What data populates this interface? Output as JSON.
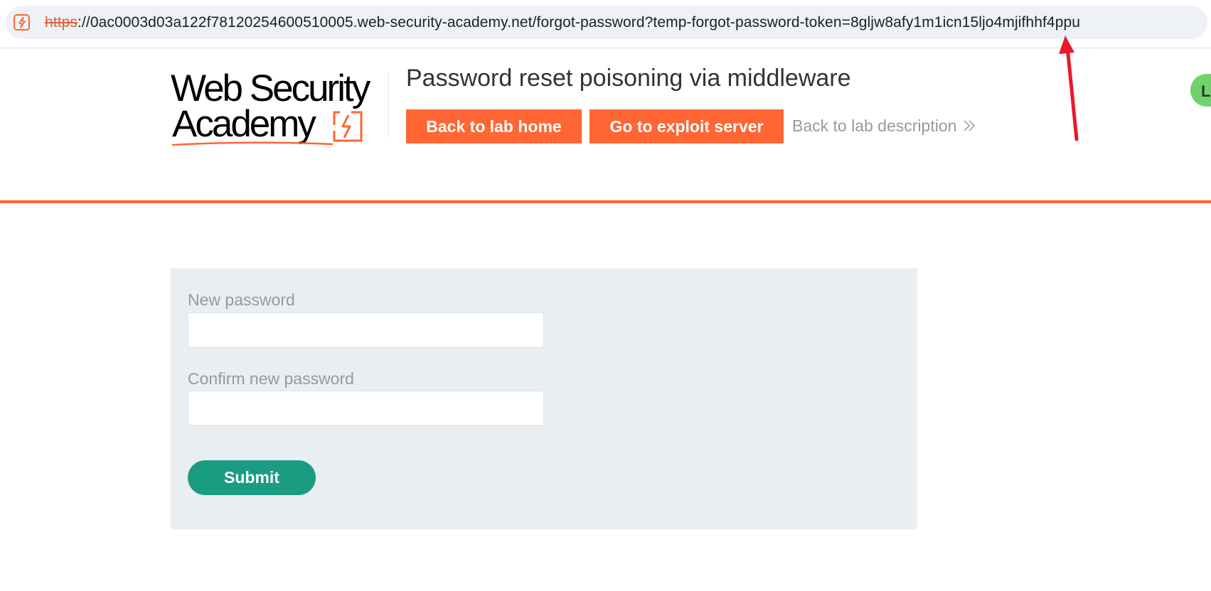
{
  "browser": {
    "url_scheme": "https",
    "url_rest": "://0ac0003d03a122f78120254600510005.web-security-academy.net/forgot-password?temp-forgot-password-token=8gljw8afy1m1icn15ljo4mjifhhf4ppu",
    "site_icon": "lightning-square-icon"
  },
  "header": {
    "logo_line1": "Web Security",
    "logo_line2": "Academy",
    "lab_title": "Password reset poisoning via middleware",
    "back_home_label": "Back to lab home",
    "exploit_server_label": "Go to exploit server",
    "lab_description_label": "Back to lab description",
    "status_pill_text": "LA"
  },
  "form": {
    "new_password_label": "New password",
    "new_password_value": "",
    "confirm_password_label": "Confirm new password",
    "confirm_password_value": "",
    "submit_label": "Submit"
  },
  "colors": {
    "accent_orange": "#ff6633",
    "submit_green": "#1a9c82",
    "status_green": "#70d16d",
    "panel_bg": "#e9eef2",
    "annotation_red": "#e8192c"
  }
}
